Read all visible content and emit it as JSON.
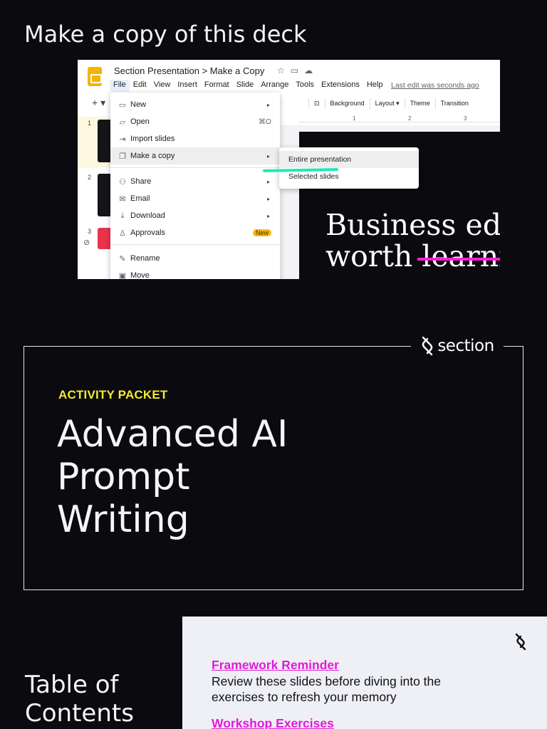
{
  "copy_section": {
    "heading": "Make a copy of this deck",
    "screenshot": {
      "doc_title": "Section Presentation > Make a Copy",
      "title_icons": [
        "star-icon",
        "folder-move-icon",
        "cloud-icon"
      ],
      "menubar": [
        "File",
        "Edit",
        "View",
        "Insert",
        "Format",
        "Slide",
        "Arrange",
        "Tools",
        "Extensions",
        "Help"
      ],
      "last_edit": "Last edit was seconds ago",
      "toolbar_buttons": [
        "Background",
        "Layout ▾",
        "Theme",
        "Transition"
      ],
      "ruler_marks": [
        "1",
        "2",
        "3"
      ],
      "thumb_numbers": [
        "1",
        "2",
        "3"
      ],
      "file_menu": {
        "new": "New",
        "open": "Open",
        "open_shortcut": "⌘O",
        "import_slides": "Import slides",
        "make_copy": "Make a copy",
        "share": "Share",
        "email": "Email",
        "download": "Download",
        "approvals": "Approvals",
        "approvals_badge": "New",
        "rename": "Rename",
        "move": "Move"
      },
      "submenu": {
        "entire": "Entire presentation",
        "selected": "Selected slides"
      },
      "slide_text_line1": "Business edu",
      "slide_text_line2a": "worth ",
      "slide_text_line2b": "learni"
    }
  },
  "packet": {
    "brand": "section",
    "kicker": "ACTIVITY PACKET",
    "title_line1": "Advanced AI",
    "title_line2": "Prompt",
    "title_line3": "Writing"
  },
  "toc": {
    "title_line1": "Table of",
    "title_line2": "Contents",
    "items": [
      {
        "link": "Framework Reminder",
        "desc": "Review these slides before diving into the exercises to refresh your memory"
      },
      {
        "link": "Workshop Exercises"
      }
    ]
  },
  "colors": {
    "background": "#0b0a0e",
    "kicker_yellow": "#f2ea2e",
    "link_magenta": "#e11bd8",
    "highlight_teal": "#1de9b6",
    "panel_gray": "#eff0f6"
  }
}
